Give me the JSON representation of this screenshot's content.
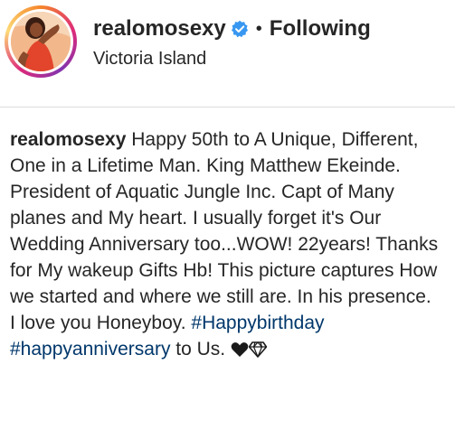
{
  "post": {
    "username": "realomosexy",
    "separator": "•",
    "follow_label": "Following",
    "location": "Victoria Island"
  },
  "caption": {
    "username": "realomosexy",
    "text_1": "Happy 50th to A Unique, Different, One in a Lifetime Man. King Matthew Ekeinde. President of Aquatic Jungle Inc. Capt of Many planes and My heart. I usually forget it's Our Wedding Anniversary too...WOW! 22years! Thanks for My wakeup Gifts Hb! This picture captures How we started and where we still are. In his presence.",
    "text_2": "I love you Honeyboy.",
    "hashtag_1": "#Happybirthday",
    "hashtag_2": "#happyanniversary",
    "text_3": "to Us."
  },
  "colors": {
    "verified": "#3897f0",
    "hashtag": "#00376b",
    "text": "#262626"
  },
  "icons": [
    "verified-badge-icon",
    "black-heart-icon",
    "gem-icon"
  ]
}
